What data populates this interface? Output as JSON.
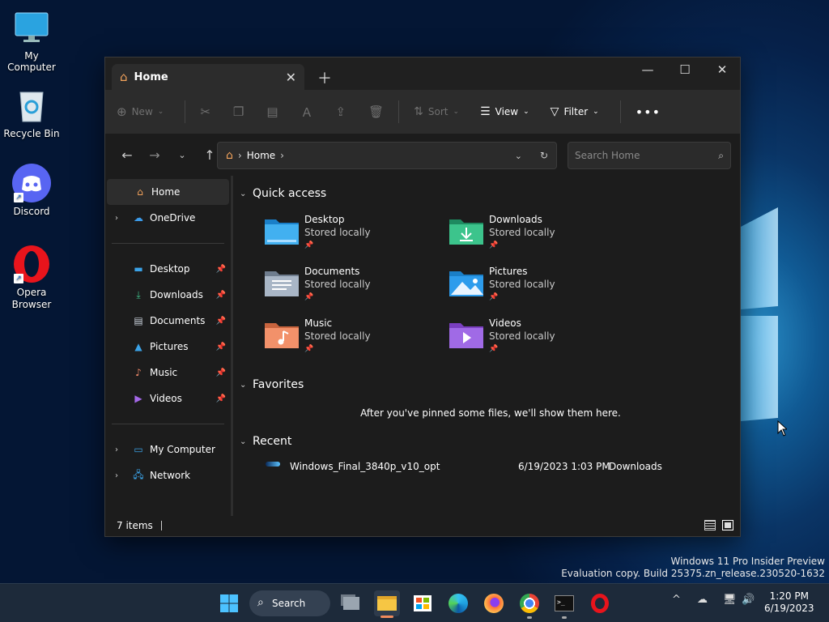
{
  "desktop": {
    "icons": [
      {
        "label": "My Computer",
        "icon": "monitor-icon"
      },
      {
        "label": "Recycle Bin",
        "icon": "recycle-bin-icon"
      },
      {
        "label": "Discord",
        "icon": "discord-icon"
      },
      {
        "label": "Opera Browser",
        "icon": "opera-icon"
      }
    ],
    "watermark": {
      "line1": "Windows 11 Pro Insider Preview",
      "line2": "Evaluation copy. Build 25375.zn_release.230520-1632"
    }
  },
  "explorer": {
    "tab_title": "Home",
    "toolbar": {
      "new": "New",
      "sort": "Sort",
      "view": "View",
      "filter": "Filter"
    },
    "address": {
      "crumb": "Home"
    },
    "search": {
      "placeholder": "Search Home"
    },
    "sidebar": {
      "home": "Home",
      "onedrive": "OneDrive",
      "pinned": [
        "Desktop",
        "Downloads",
        "Documents",
        "Pictures",
        "Music",
        "Videos"
      ],
      "my_computer": "My Computer",
      "network": "Network"
    },
    "quick_access": {
      "title": "Quick access",
      "items": [
        {
          "name": "Desktop",
          "status": "Stored locally"
        },
        {
          "name": "Downloads",
          "status": "Stored locally"
        },
        {
          "name": "Documents",
          "status": "Stored locally"
        },
        {
          "name": "Pictures",
          "status": "Stored locally"
        },
        {
          "name": "Music",
          "status": "Stored locally"
        },
        {
          "name": "Videos",
          "status": "Stored locally"
        }
      ]
    },
    "favorites": {
      "title": "Favorites",
      "empty_message": "After you've pinned some files, we'll show them here."
    },
    "recent": {
      "title": "Recent",
      "files": [
        {
          "name": "Windows_Final_3840p_v10_opt",
          "date": "6/19/2023 1:03 PM",
          "location": "Downloads"
        }
      ]
    },
    "status_bar": {
      "count": "7 items"
    }
  },
  "taskbar": {
    "search_label": "Search",
    "clock": {
      "time": "1:20 PM",
      "date": "6/19/2023"
    }
  }
}
